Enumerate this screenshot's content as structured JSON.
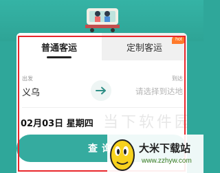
{
  "tabs": {
    "regular": "普通客运",
    "custom": "定制客运",
    "hot_badge": "hot"
  },
  "route": {
    "from_label": "出发",
    "from_value": "义乌",
    "to_label": "到达",
    "to_placeholder": "请选择到达地"
  },
  "date": "02月03日 星期四",
  "query_button": "查询",
  "watermark": "当下软件园",
  "logo": {
    "title": "大米下载站",
    "url": "www.zzhyw.com"
  },
  "colors": {
    "accent": "#35ab9f",
    "highlight": "#e8262a",
    "badge": "#ff7a2b"
  }
}
